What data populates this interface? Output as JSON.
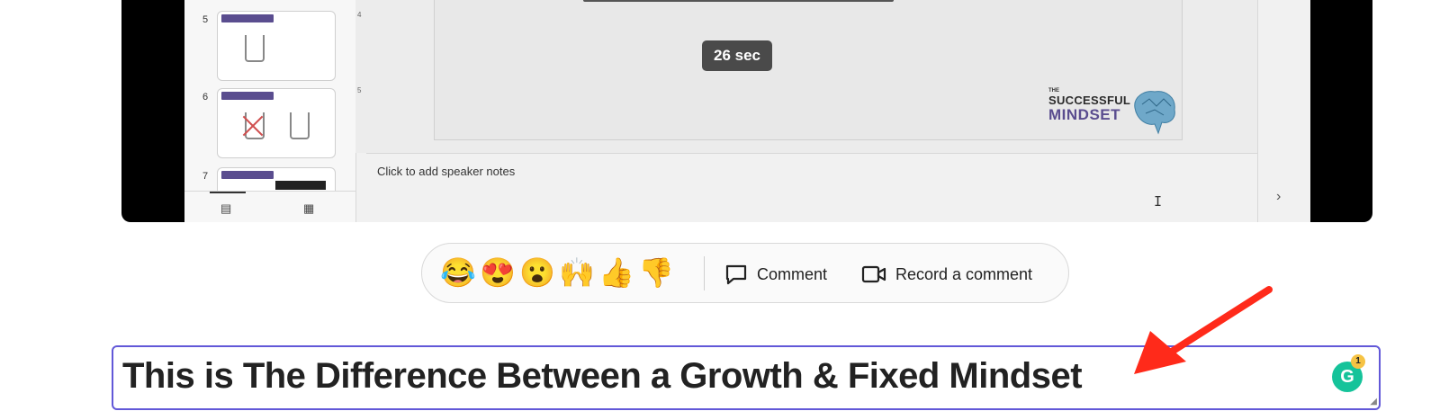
{
  "video": {
    "slides": [
      {
        "number": "5"
      },
      {
        "number": "6"
      },
      {
        "number": "7"
      }
    ],
    "timer_badge": "26 sec",
    "ruler_marks": [
      "4",
      "5"
    ],
    "logo": {
      "small": "THE",
      "line1": "SUCCESSFUL",
      "line2": "MINDSET"
    },
    "speaker_notes_placeholder": "Click to add speaker notes"
  },
  "reactions": {
    "emojis": [
      "😂",
      "😍",
      "😮",
      "🙌",
      "👍",
      "👎"
    ],
    "comment_label": "Comment",
    "record_label": "Record a comment"
  },
  "title_input": {
    "value": "This is The Difference Between a Growth & Fixed Mindset",
    "grammarly_letter": "G",
    "grammarly_count": "1"
  },
  "colors": {
    "input_border": "#6258d8",
    "arrow": "#ff2a1a",
    "grammarly": "#15c39a",
    "brand_purple": "#5a4d8f"
  }
}
